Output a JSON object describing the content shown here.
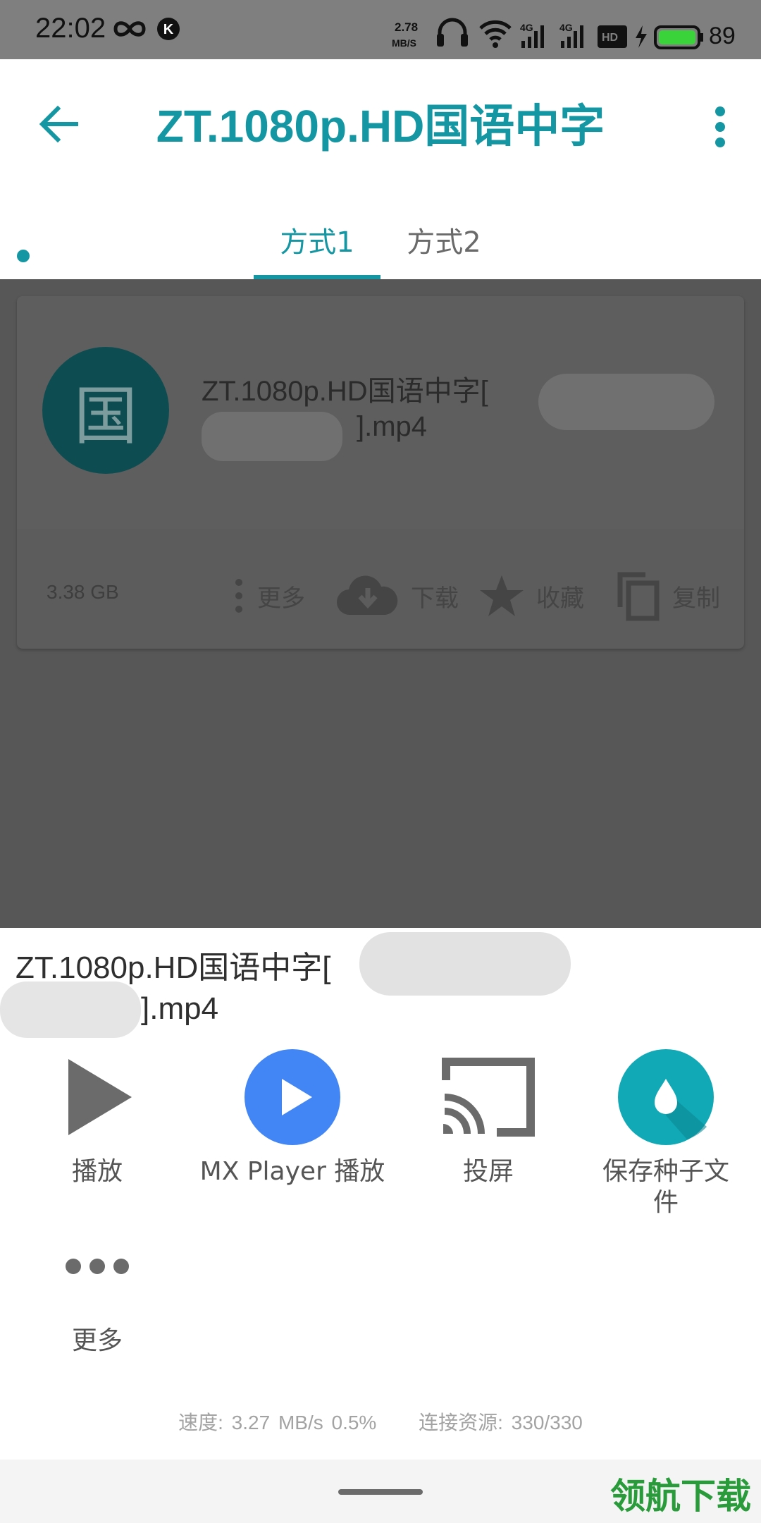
{
  "status_bar": {
    "time": "22:02",
    "net_speed_value": "2.78",
    "net_speed_unit": "MB/S",
    "signal_label": "4G",
    "signal_label_2": "4G",
    "battery_level": "89",
    "icons": [
      "infinity-icon",
      "k-app-icon",
      "headphones-icon",
      "wifi-icon",
      "signal-icon",
      "hd-icon",
      "charging-icon",
      "battery-icon"
    ]
  },
  "app_bar": {
    "title": "ZT.1080p.HD国语中字",
    "tabs": [
      {
        "label": "方式1",
        "selected": true
      },
      {
        "label": "方式2",
        "selected": false
      }
    ]
  },
  "card": {
    "avatar_char": "国",
    "title": "ZT.1080p.HD国语中字[",
    "title_tail": "].mp4",
    "size": "3.38 GB",
    "actions": [
      {
        "label": "更多"
      },
      {
        "label": "下载"
      },
      {
        "label": "收藏"
      },
      {
        "label": "复制"
      }
    ]
  },
  "sheet": {
    "title": "ZT.1080p.HD国语中字[",
    "title_tail": "].mp4",
    "options": [
      {
        "label": "播放"
      },
      {
        "label": "MX Player 播放"
      },
      {
        "label": "投屏"
      },
      {
        "label": "保存种子文件"
      },
      {
        "label": "更多"
      }
    ],
    "speed": "速度: 3.27 MB/s  0.5%",
    "connections": "连接资源: 330/330"
  },
  "colors": {
    "accent": "#1597a3",
    "mx_blue": "#4285f4",
    "teal_icon": "#11a9b6",
    "watermark": "#2a9b3b"
  },
  "watermark": "领航下载"
}
